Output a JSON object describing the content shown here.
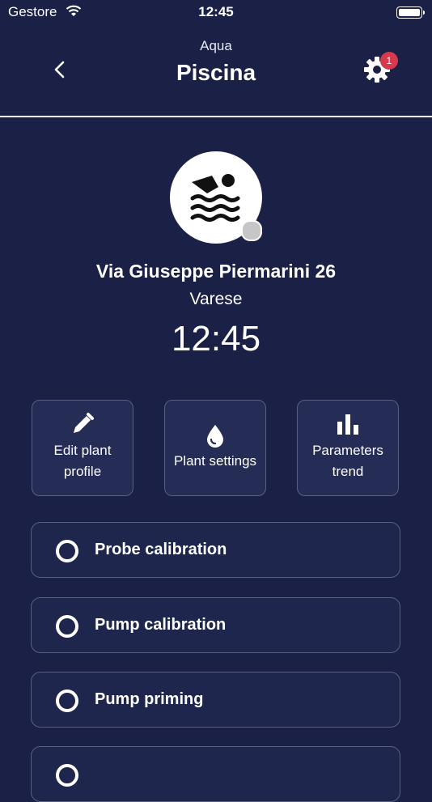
{
  "status_bar": {
    "carrier": "Gestore",
    "time": "12:45"
  },
  "header": {
    "subtitle": "Aqua",
    "title": "Piscina",
    "notification_count": "1"
  },
  "plant": {
    "address": "Via Giuseppe Piermarini 26",
    "city": "Varese",
    "local_time": "12:45"
  },
  "tiles": [
    {
      "label": "Edit plant profile",
      "icon": "pencil-icon"
    },
    {
      "label": "Plant settings",
      "icon": "drop-icon"
    },
    {
      "label": "Parameters trend",
      "icon": "bar-chart-icon"
    }
  ],
  "actions": [
    {
      "label": "Probe calibration"
    },
    {
      "label": "Pump calibration"
    },
    {
      "label": "Pump priming"
    }
  ],
  "colors": {
    "background": "#1b2046",
    "card": "#252c56",
    "border": "#59607f",
    "badge": "#d6394e"
  }
}
